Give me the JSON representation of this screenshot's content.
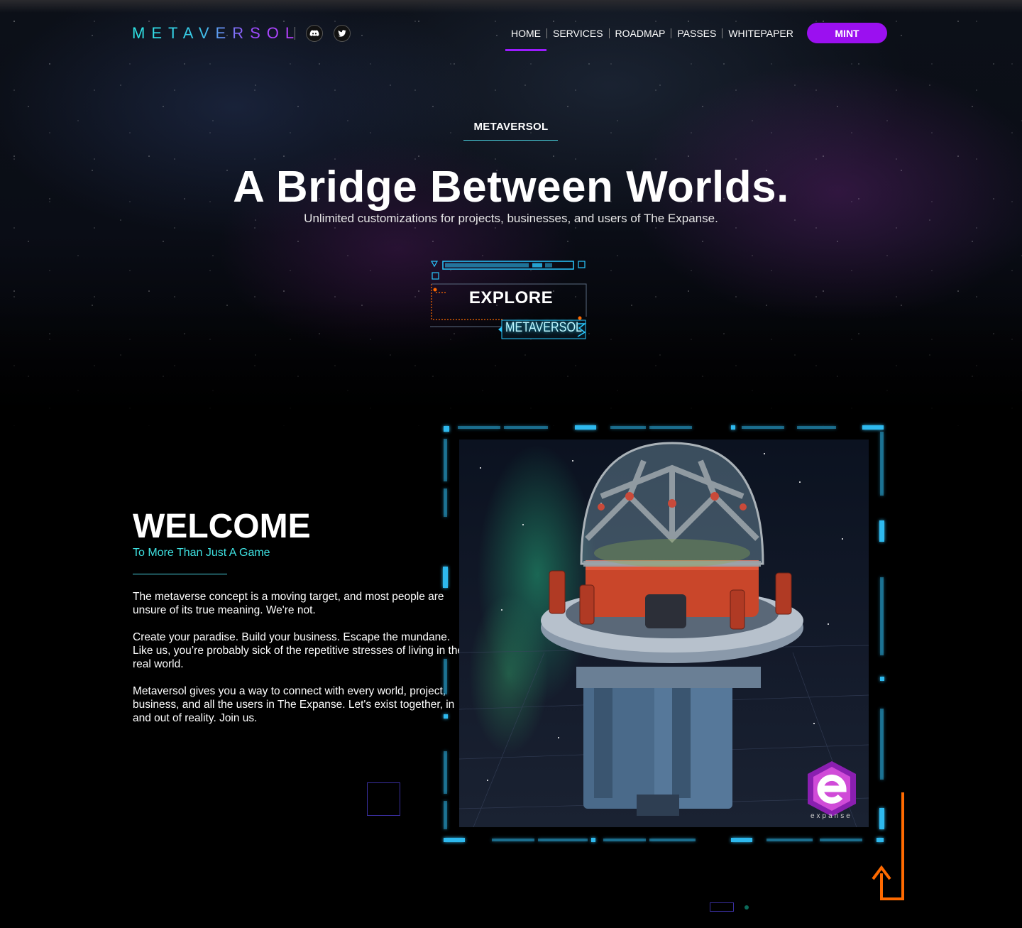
{
  "header": {
    "logo": "METAVERSOL",
    "nav": [
      "HOME",
      "SERVICES",
      "ROADMAP",
      "PASSES",
      "WHITEPAPER"
    ],
    "active_nav": "HOME",
    "mint_label": "MINT",
    "social_icons": [
      "discord-icon",
      "twitter-icon"
    ]
  },
  "hero": {
    "eyebrow": "METAVERSOL",
    "title": "A Bridge Between Worlds.",
    "subtitle": "Unlimited customizations for projects, businesses, and users of The Expanse.",
    "cta_label": "EXPLORE",
    "cta_tag": "METAVERSOL"
  },
  "welcome": {
    "title": "WELCOME",
    "subtitle": "To More Than Just A Game",
    "paragraphs": [
      "The metaverse concept is a moving target, and most people are unsure of its true meaning. We're not.",
      "Create your paradise. Build your business. Escape the mundane. Like us, you’re probably sick of the repetitive stresses of living in the real world.",
      "Metaversol gives you a way to connect with every world, project, business, and all the users in The Expanse. Let's exist together, in and out of reality. Join us."
    ],
    "image_badge": "expanse"
  },
  "colors": {
    "accent_purple": "#9b10f0",
    "accent_cyan": "#3ee0e0",
    "hud_cyan": "#29c8ff",
    "hud_orange": "#ff6a00"
  }
}
